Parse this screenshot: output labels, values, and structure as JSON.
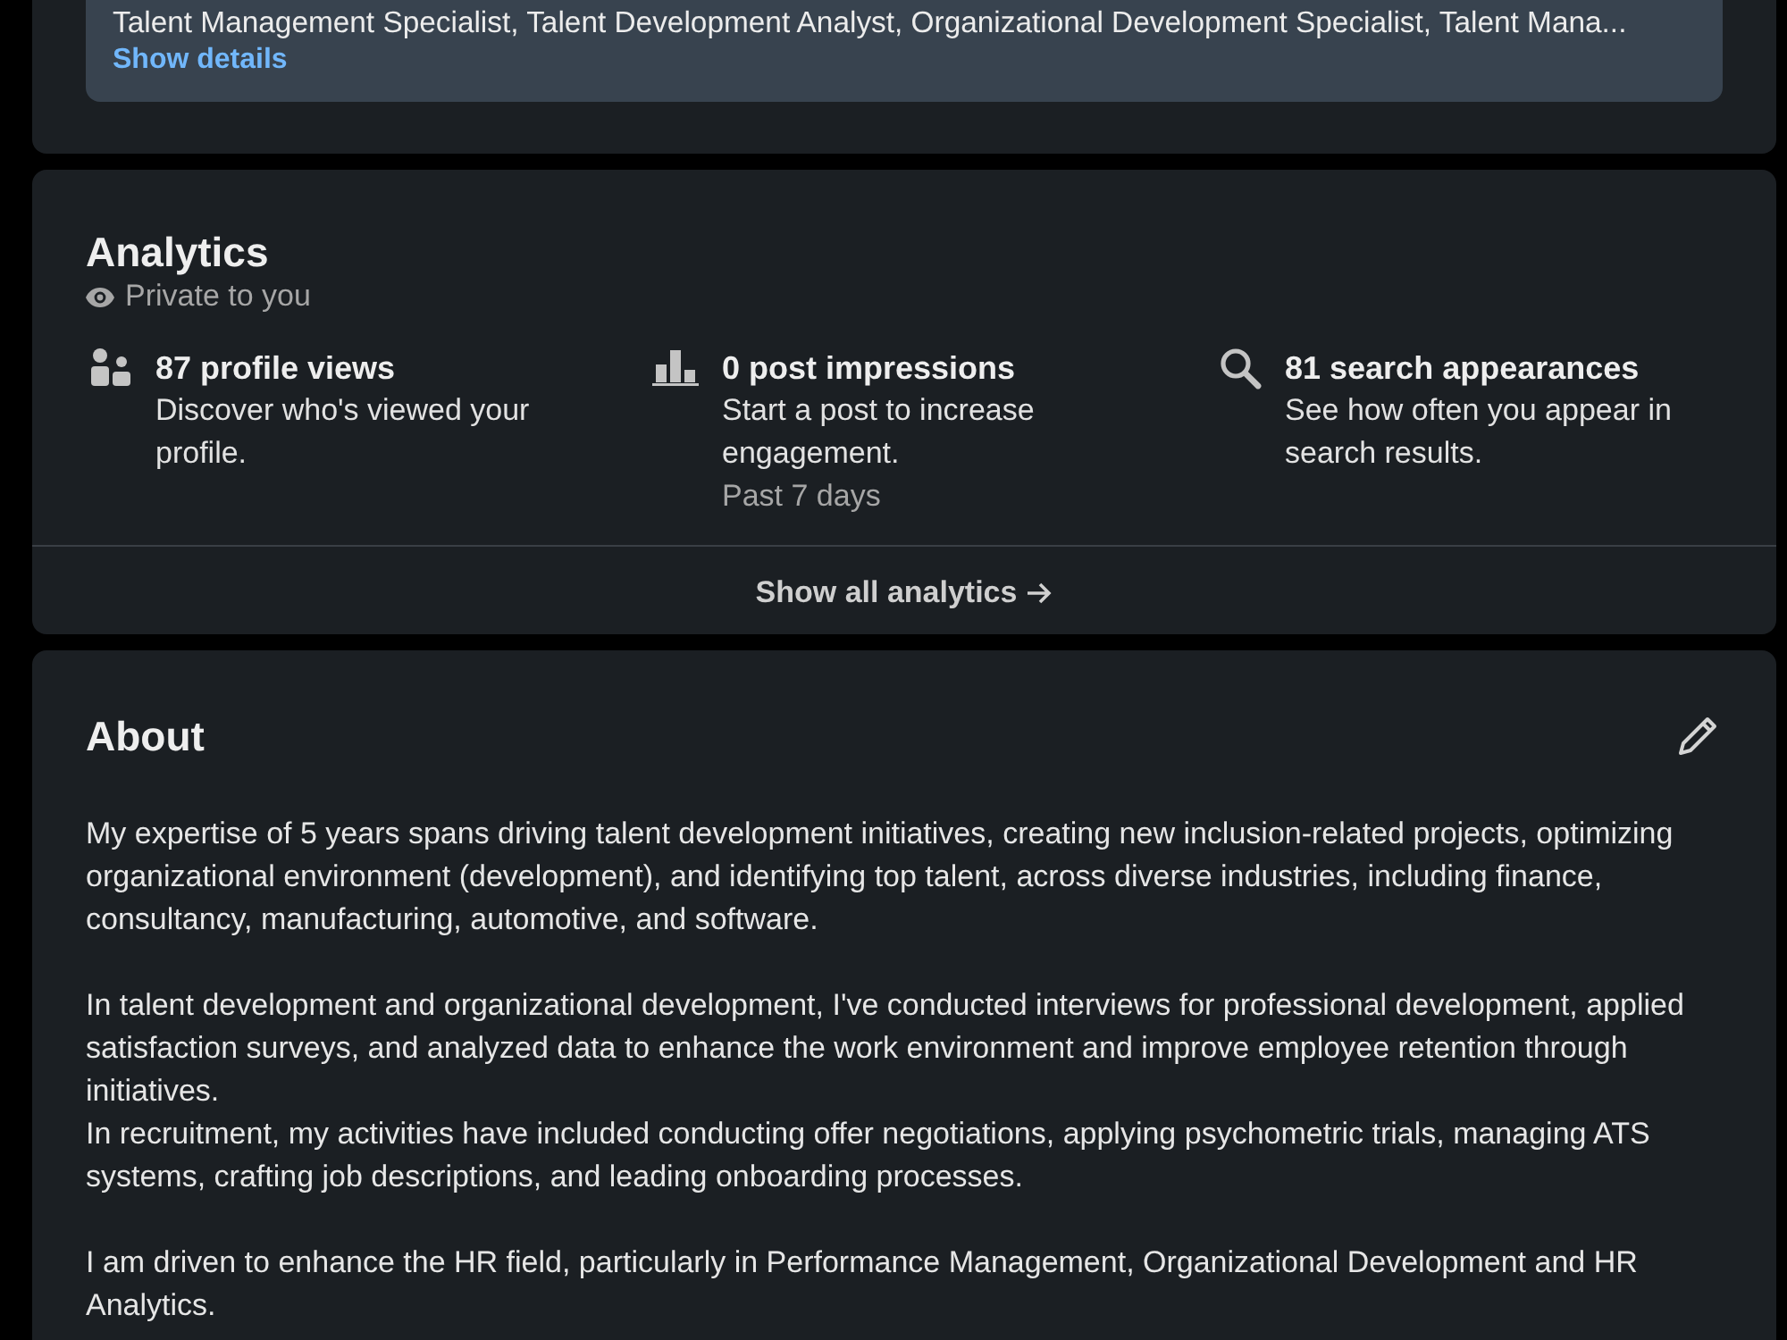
{
  "top_card": {
    "roles": "Talent Management Specialist, Talent Development Analyst, Organizational Development Specialist, Talent Mana...",
    "link": "Show details"
  },
  "analytics": {
    "title": "Analytics",
    "visibility": "Private to you",
    "stats": [
      {
        "kind": "people",
        "title": "87 profile views",
        "description": "Discover who's viewed your profile."
      },
      {
        "kind": "bar_chart",
        "title": "0 post impressions",
        "description": "Start a post to increase engagement.",
        "note": "Past 7 days"
      },
      {
        "kind": "search",
        "title": "81 search appearances",
        "description": "See how often you appear in search results."
      }
    ],
    "footer_link": "Show all analytics"
  },
  "about": {
    "title": "About",
    "paragraphs": [
      "My expertise of 5 years spans driving talent development initiatives, creating new inclusion-related projects, optimizing organizational environment (development), and identifying top talent, across diverse industries, including finance, consultancy, manufacturing, automotive, and software.",
      "In talent development and organizational development, I've conducted interviews for professional development, applied satisfaction surveys, and analyzed data to enhance the work environment and improve employee retention through initiatives.\nIn recruitment, my activities have included conducting offer negotiations, applying psychometric trials, managing ATS systems, crafting job descriptions, and leading onboarding processes.",
      "I am driven to enhance the HR field, particularly in Performance Management, Organizational Development and HR Analytics."
    ]
  }
}
